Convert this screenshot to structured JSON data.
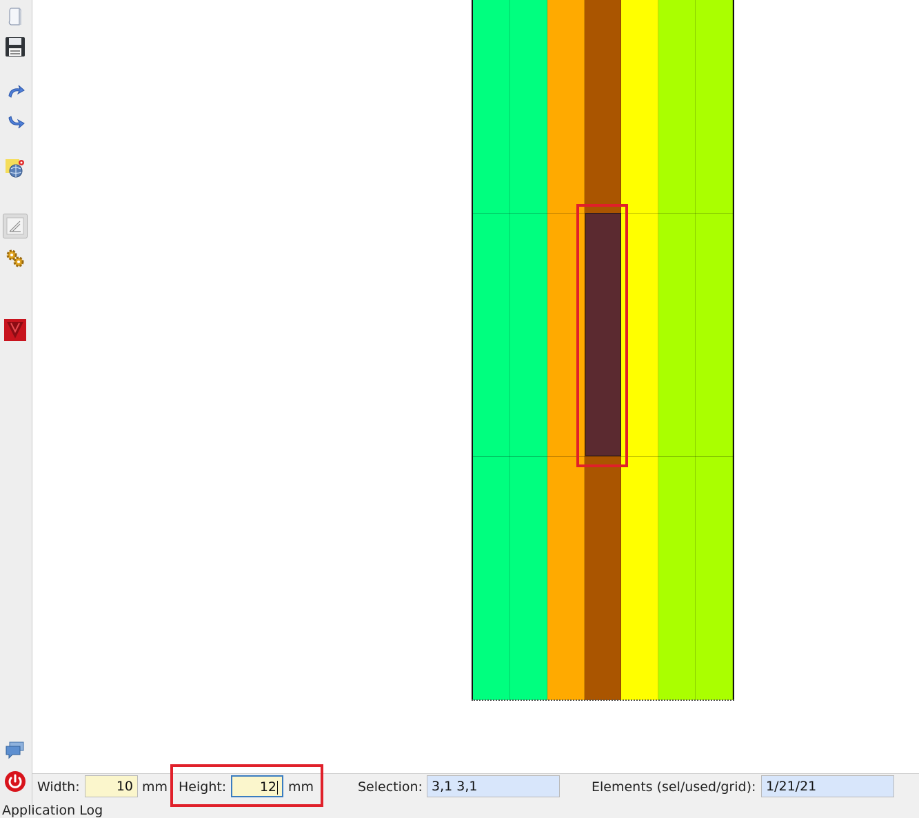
{
  "toolbar": {
    "buttons": [
      {
        "name": "new-icon"
      },
      {
        "name": "save-icon"
      },
      {
        "name": "undo-icon"
      },
      {
        "name": "redo-icon"
      },
      {
        "name": "map-location-icon"
      },
      {
        "name": "draw-tool-icon",
        "active": true
      },
      {
        "name": "settings-gears-icon"
      },
      {
        "name": "red-logo-icon"
      },
      {
        "name": "chat-icon"
      },
      {
        "name": "power-icon"
      }
    ]
  },
  "grid": {
    "columns": 7,
    "rows": 3,
    "column_colors": [
      "#00ff7f",
      "#00ff7f",
      "#ffaa00",
      "#aa5500",
      "#ffff00",
      "#aaff00",
      "#aaff00"
    ],
    "selected_cell_color": "#5b2a30",
    "selected_cell": {
      "col": 3,
      "row": 1
    }
  },
  "status": {
    "width_label": "Width:",
    "width_value": "10",
    "width_unit": "mm",
    "height_label": "Height:",
    "height_value": "12",
    "height_unit": "mm",
    "selection_label": "Selection:",
    "selection_value": "3,1  3,1",
    "elements_label": "Elements (sel/used/grid):",
    "elements_value": "1/21/21"
  },
  "log": {
    "title": "Application Log"
  },
  "accent": "#e0202a"
}
